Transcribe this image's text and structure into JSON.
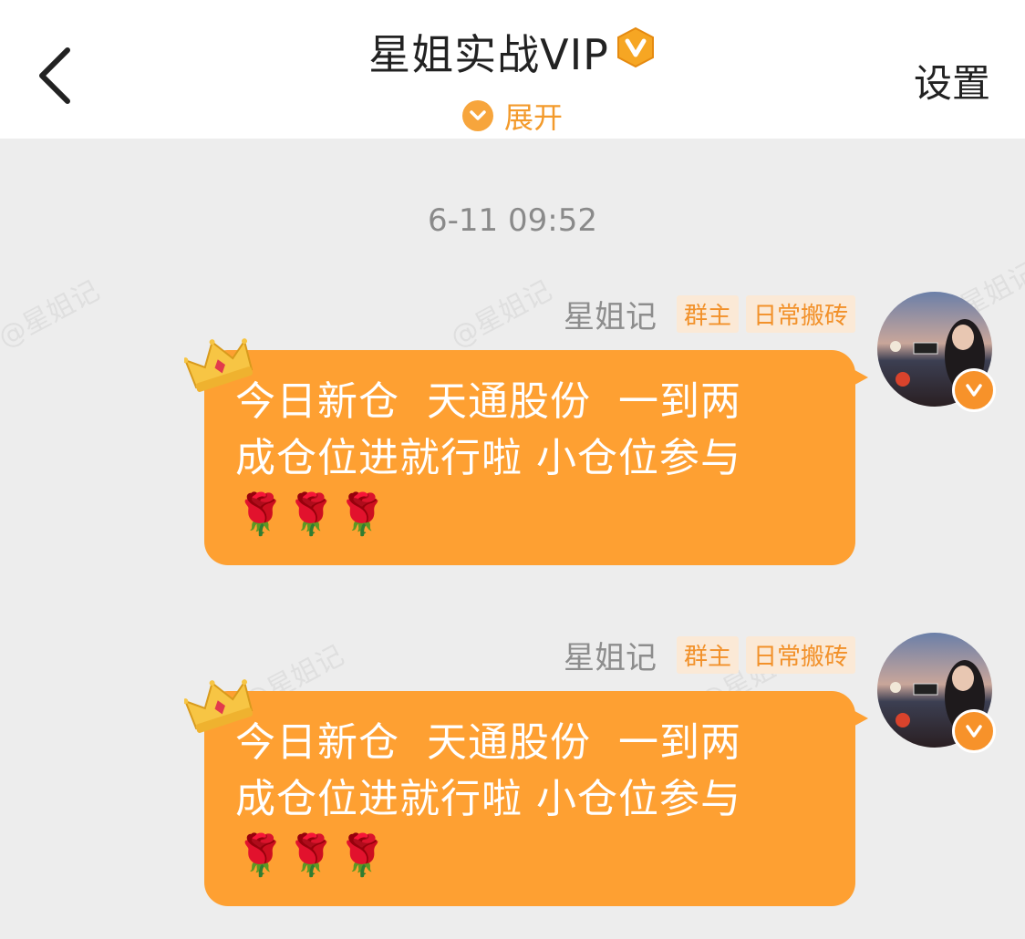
{
  "header": {
    "title": "星姐实战VIP",
    "expand_label": "展开",
    "settings_label": "设置"
  },
  "timestamp": "6-11 09:52",
  "watermark": "@星姐记",
  "messages": [
    {
      "sender": "星姐记",
      "badges": [
        "群主",
        "日常搬砖"
      ],
      "text": "今日新仓  天通股份  一到两\n成仓位进就行啦 小仓位参与\n🌹🌹🌹"
    },
    {
      "sender": "星姐记",
      "badges": [
        "群主",
        "日常搬砖"
      ],
      "text": "今日新仓  天通股份  一到两\n成仓位进就行啦 小仓位参与\n🌹🌹🌹"
    }
  ],
  "colors": {
    "accent": "#f39a2b",
    "bubble": "#fea032",
    "badge_bg": "#fbe9d6",
    "background": "#ededed"
  },
  "icons": [
    "chevron-left-icon",
    "vip-badge-icon",
    "chevron-down-icon",
    "crown-icon",
    "verified-v-icon"
  ]
}
